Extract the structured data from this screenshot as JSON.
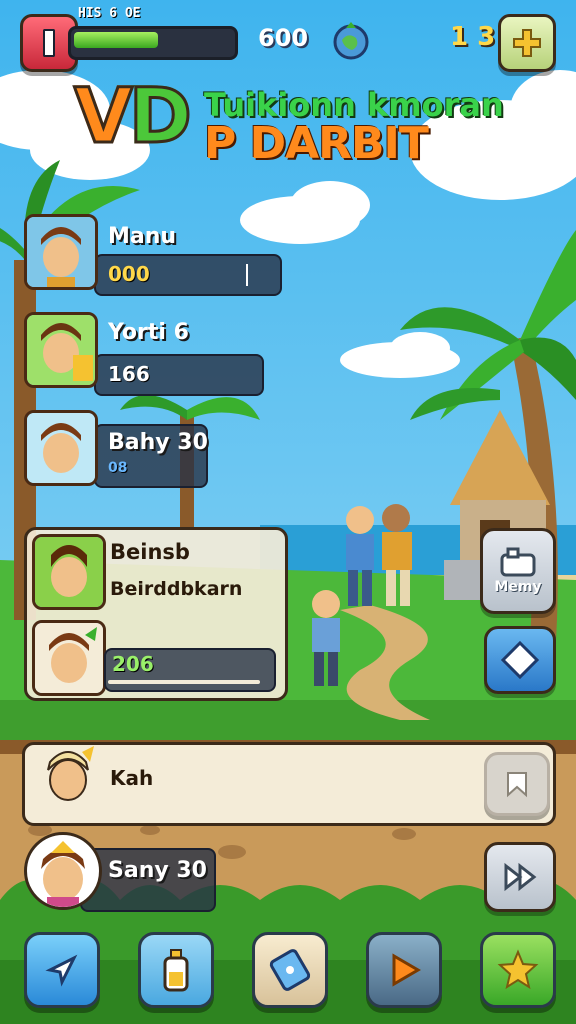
{
  "hud": {
    "hp_label": "HIS 6 OE",
    "hp_fraction": 0.55,
    "coins": "600",
    "gems": "1 3",
    "globe_icon": "globe-icon",
    "add_icon": "plus-icon"
  },
  "title": {
    "logo_letters": "VD",
    "line1": "Tuikionn kmoran",
    "line2": "P DARBIT"
  },
  "roster": [
    {
      "name": "Manu",
      "value": "000"
    },
    {
      "name": "Yorti 6",
      "value": "166"
    },
    {
      "name": "Bahy 30",
      "value": "08"
    }
  ],
  "selected_card": {
    "name": "Beinsb",
    "subtitle": "Beirddbkarn",
    "value": "206",
    "progress": 0.95
  },
  "side_buttons": {
    "map_label": "Memy"
  },
  "chat_row": {
    "name": "Kah"
  },
  "player_row": {
    "name": "Sany 30"
  },
  "bottom_bar": [
    {
      "icon": "send-arrow-icon"
    },
    {
      "icon": "bottle-icon"
    },
    {
      "icon": "device-icon"
    },
    {
      "icon": "play-icon"
    },
    {
      "icon": "star-icon"
    }
  ],
  "colors": {
    "sky": "#5ec4f0",
    "grass": "#4cb83a",
    "path": "#c99a5a",
    "accent_orange": "#ff8a1c",
    "accent_green": "#3ad24a"
  }
}
